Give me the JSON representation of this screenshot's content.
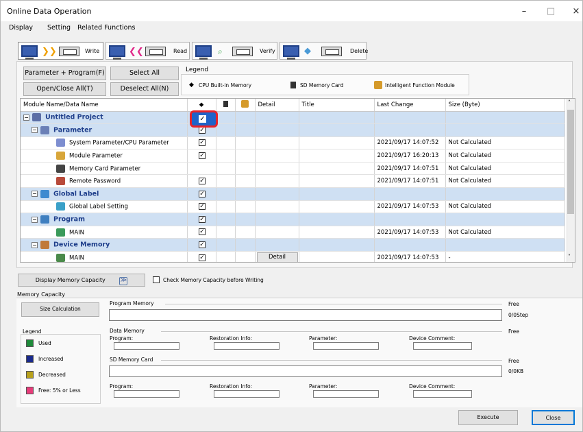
{
  "window": {
    "title": "Online Data Operation",
    "minimize": "–",
    "maximize": "□",
    "close": "×"
  },
  "menu": [
    "Display",
    "Setting",
    "Related Functions"
  ],
  "operations": [
    {
      "label": "Write",
      "selected": true
    },
    {
      "label": "Read",
      "selected": false
    },
    {
      "label": "Verify",
      "selected": false
    },
    {
      "label": "Delete",
      "selected": false
    }
  ],
  "buttons": {
    "param_program": "Parameter + Program(F)",
    "select_all": "Select All",
    "open_close_all": "Open/Close All(T)",
    "deselect_all": "Deselect All(N)"
  },
  "legend": {
    "title": "Legend",
    "items": [
      "CPU Built-in Memory",
      "SD Memory Card",
      "Intelligent Function Module"
    ]
  },
  "grid": {
    "headers": [
      "Module Name/Data Name",
      "",
      "",
      "",
      "Detail",
      "Title",
      "Last Change",
      "Size (Byte)"
    ],
    "rows": [
      {
        "level": 0,
        "group": true,
        "expand": "−",
        "icon": "project",
        "name": "Untitled Project",
        "cpu": "✓",
        "hot": true,
        "last": "",
        "size": ""
      },
      {
        "level": 1,
        "group": true,
        "expand": "−",
        "icon": "param",
        "name": "Parameter",
        "cpu": "✓",
        "last": "",
        "size": ""
      },
      {
        "level": 2,
        "icon": "sysparam",
        "name": "System Parameter/CPU Parameter",
        "cpu": "✓",
        "last": "2021/09/17 14:07:52",
        "size": "Not Calculated"
      },
      {
        "level": 2,
        "icon": "modparam",
        "name": "Module Parameter",
        "cpu": "✓",
        "last": "2021/09/17 16:20:13",
        "size": "Not Calculated"
      },
      {
        "level": 2,
        "icon": "memcard",
        "name": "Memory Card Parameter",
        "cpu": "",
        "last": "2021/09/17 14:07:51",
        "size": "Not Calculated"
      },
      {
        "level": 2,
        "icon": "password",
        "name": "Remote Password",
        "cpu": "✓",
        "last": "2021/09/17 14:07:51",
        "size": "Not Calculated"
      },
      {
        "level": 1,
        "group": true,
        "expand": "−",
        "icon": "globallabel",
        "name": "Global Label",
        "cpu": "✓",
        "last": "",
        "size": ""
      },
      {
        "level": 2,
        "icon": "globalset",
        "name": "Global Label Setting",
        "cpu": "✓",
        "last": "2021/09/17 14:07:53",
        "size": "Not Calculated"
      },
      {
        "level": 1,
        "group": true,
        "expand": "−",
        "icon": "program",
        "name": "Program",
        "cpu": "✓",
        "last": "",
        "size": ""
      },
      {
        "level": 2,
        "icon": "main",
        "name": "MAIN",
        "cpu": "✓",
        "last": "2021/09/17 14:07:53",
        "size": "Not Calculated"
      },
      {
        "level": 1,
        "group": true,
        "expand": "−",
        "icon": "devmem",
        "name": "Device Memory",
        "cpu": "✓",
        "last": "",
        "size": ""
      },
      {
        "level": 2,
        "icon": "devmain",
        "name": "MAIN",
        "cpu": "✓",
        "detail": "Detail",
        "last": "2021/09/17 14:07:53",
        "size": "-"
      }
    ]
  },
  "display_memory": {
    "button": "Display Memory Capacity",
    "expander": "≫",
    "check_label": "Check Memory Capacity before Writing"
  },
  "memory": {
    "title": "Memory Capacity",
    "size_calc": "Size Calculation",
    "legend_title": "Legend",
    "legend": [
      {
        "label": "Used",
        "color": "#1e8a3a"
      },
      {
        "label": "Increased",
        "color": "#1a2a8c"
      },
      {
        "label": "Decreased",
        "color": "#b8a11c"
      },
      {
        "label": "Free: 5% or Less",
        "color": "#e83c7a"
      }
    ],
    "program_memory": "Program Memory",
    "data_memory": "Data Memory",
    "sd_card": "SD Memory Card",
    "free": "Free",
    "prog_free": "0/0Step",
    "sd_free": "0/0KB",
    "sub": [
      "Program:",
      "Restoration Info:",
      "Parameter:",
      "Device Comment:"
    ]
  },
  "footer": {
    "execute": "Execute",
    "close": "Close"
  }
}
